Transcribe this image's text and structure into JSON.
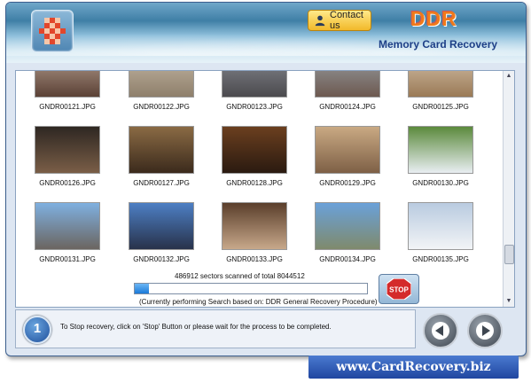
{
  "header": {
    "contact_label": "Contact us",
    "brand": "DDR",
    "subtitle": "Memory Card Recovery"
  },
  "thumbnails": [
    {
      "name": "GNDR00121.JPG",
      "colors": [
        "#b9a393",
        "#5b4136"
      ]
    },
    {
      "name": "GNDR00122.JPG",
      "colors": [
        "#c8bba8",
        "#8e7f6b"
      ]
    },
    {
      "name": "GNDR00123.JPG",
      "colors": [
        "#8a8d94",
        "#4b4a4e"
      ]
    },
    {
      "name": "GNDR00124.JPG",
      "colors": [
        "#9aa3a8",
        "#6d5950"
      ]
    },
    {
      "name": "GNDR00125.JPG",
      "colors": [
        "#d8c6b0",
        "#9a7a56"
      ]
    },
    {
      "name": "GNDR00126.JPG",
      "colors": [
        "#2e2722",
        "#7a5e47"
      ]
    },
    {
      "name": "GNDR00127.JPG",
      "colors": [
        "#8a6a44",
        "#3b2a1c"
      ]
    },
    {
      "name": "GNDR00128.JPG",
      "colors": [
        "#6b3f1f",
        "#2a1a10"
      ]
    },
    {
      "name": "GNDR00129.JPG",
      "colors": [
        "#c9a983",
        "#7e6046"
      ]
    },
    {
      "name": "GNDR00130.JPG",
      "colors": [
        "#5b8a3c",
        "#e9eef2"
      ]
    },
    {
      "name": "GNDR00131.JPG",
      "colors": [
        "#7fb0e0",
        "#6b6560"
      ]
    },
    {
      "name": "GNDR00132.JPG",
      "colors": [
        "#4d7fc4",
        "#28324a"
      ]
    },
    {
      "name": "GNDR00133.JPG",
      "colors": [
        "#5a3e2b",
        "#c7a88a"
      ]
    },
    {
      "name": "GNDR00134.JPG",
      "colors": [
        "#6aa1d9",
        "#7f8a6c"
      ]
    },
    {
      "name": "GNDR00135.JPG",
      "colors": [
        "#b9cbe0",
        "#f2f4f6"
      ]
    }
  ],
  "progress": {
    "scanned_text": "486912 sectors scanned of total 8044512",
    "fraction": 0.0605,
    "based_text": "(Currently performing Search based on:  DDR General Recovery Procedure)",
    "stop_label": "STOP"
  },
  "footer": {
    "info_glyph": "1",
    "instruction": "To Stop recovery, click on 'Stop' Button or please wait for the process to be completed."
  },
  "url": "www.CardRecovery.biz",
  "colors": {
    "brand": "#f07a1a",
    "subtitle": "#1d3f87",
    "progress_fill": "#1a7ad8",
    "stop_red": "#d42b2b",
    "url_bg": "#2f5cb8"
  }
}
